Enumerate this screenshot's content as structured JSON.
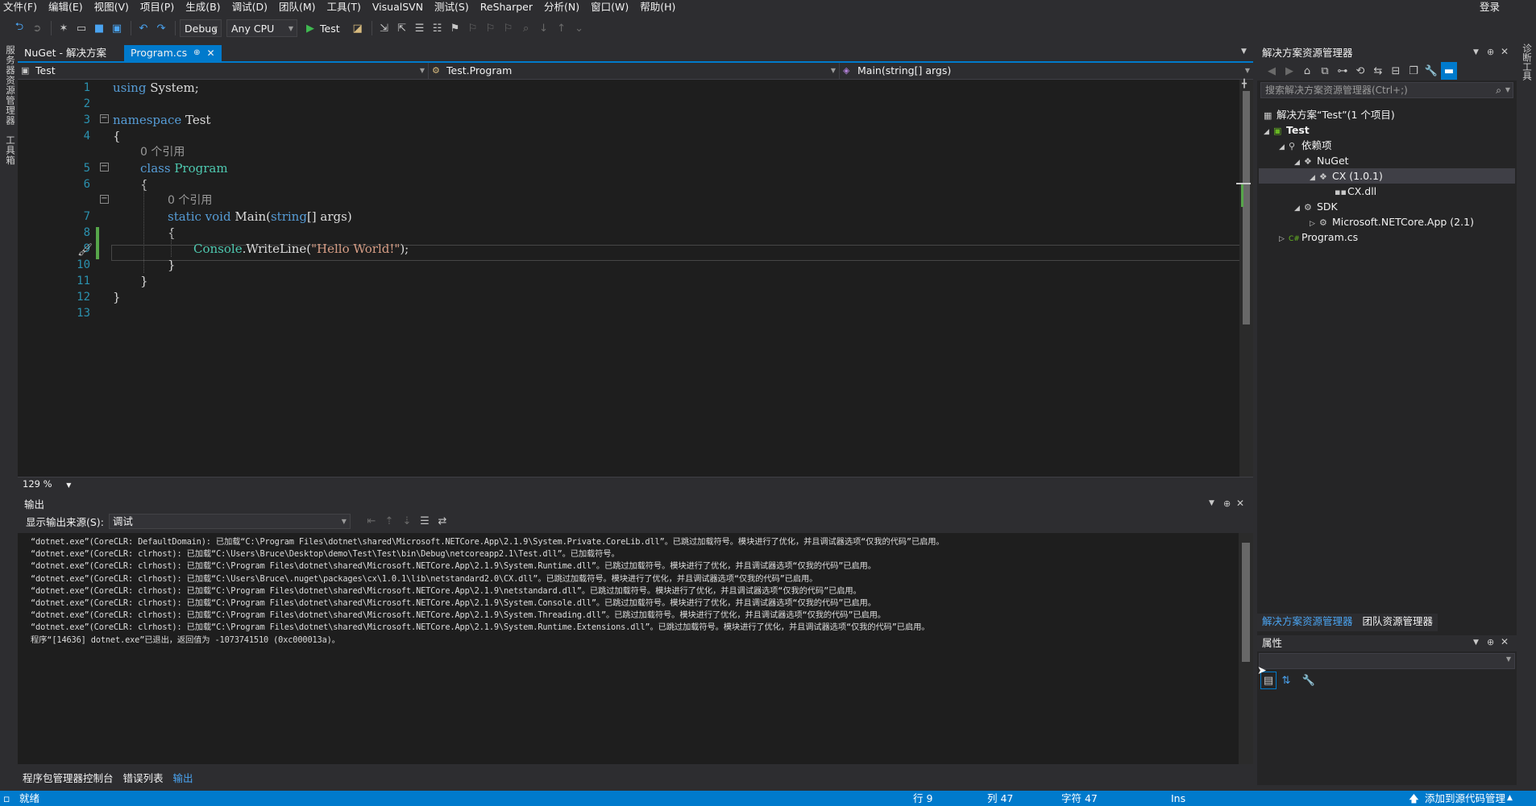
{
  "menu": {
    "items": [
      "文件(F)",
      "编辑(E)",
      "视图(V)",
      "项目(P)",
      "生成(B)",
      "调试(D)",
      "团队(M)",
      "工具(T)",
      "VisualSVN",
      "测试(S)",
      "ReSharper",
      "分析(N)",
      "窗口(W)",
      "帮助(H)"
    ],
    "login": "登录"
  },
  "toolbar": {
    "config": "Debug",
    "platform": "Any CPU",
    "run_label": "Test"
  },
  "left_strip": {
    "server_explorer": "服务器资源管理器",
    "toolbox": "工具箱"
  },
  "right_strip": {
    "diag": "诊断工具"
  },
  "editor_tabs": [
    {
      "label": "NuGet - 解决方案"
    },
    {
      "label": "Program.cs",
      "active": true
    }
  ],
  "nav": {
    "project": "Test",
    "type": "Test.Program",
    "member": "Main(string[] args)"
  },
  "editor": {
    "line_numbers": [
      "1",
      "2",
      "3",
      "4",
      "5",
      "6",
      "7",
      "8",
      "9",
      "10",
      "11",
      "12",
      "13"
    ],
    "code": {
      "using_kw": "using",
      "using_ns": " System;",
      "ns_kw": "namespace",
      "ns_name": " Test",
      "brace_open": "{",
      "brace_close": "}",
      "refs": "0 个引用",
      "class_kw": "class",
      "class_name": " Program",
      "static_kw": "static",
      "void_kw": " void",
      "main_name": " Main(",
      "string_kw": "string",
      "args": "[] args)",
      "console_type": "Console",
      "writeline": ".WriteLine(",
      "hello_str": "\"Hello World!\"",
      "end_stmt": ");"
    },
    "zoom": "129 %"
  },
  "output": {
    "title": "输出",
    "source_label": "显示输出来源(S):",
    "source_value": "调试",
    "lines": [
      "“dotnet.exe”(CoreCLR: DefaultDomain): 已加载“C:\\Program Files\\dotnet\\shared\\Microsoft.NETCore.App\\2.1.9\\System.Private.CoreLib.dll”。已跳过加载符号。模块进行了优化，并且调试器选项“仅我的代码”已启用。",
      "“dotnet.exe”(CoreCLR: clrhost): 已加载“C:\\Users\\Bruce\\Desktop\\demo\\Test\\Test\\bin\\Debug\\netcoreapp2.1\\Test.dll”。已加载符号。",
      "“dotnet.exe”(CoreCLR: clrhost): 已加载“C:\\Program Files\\dotnet\\shared\\Microsoft.NETCore.App\\2.1.9\\System.Runtime.dll”。已跳过加载符号。模块进行了优化，并且调试器选项“仅我的代码”已启用。",
      "“dotnet.exe”(CoreCLR: clrhost): 已加载“C:\\Users\\Bruce\\.nuget\\packages\\cx\\1.0.1\\lib\\netstandard2.0\\CX.dll”。已跳过加载符号。模块进行了优化，并且调试器选项“仅我的代码”已启用。",
      "“dotnet.exe”(CoreCLR: clrhost): 已加载“C:\\Program Files\\dotnet\\shared\\Microsoft.NETCore.App\\2.1.9\\netstandard.dll”。已跳过加载符号。模块进行了优化，并且调试器选项“仅我的代码”已启用。",
      "“dotnet.exe”(CoreCLR: clrhost): 已加载“C:\\Program Files\\dotnet\\shared\\Microsoft.NETCore.App\\2.1.9\\System.Console.dll”。已跳过加载符号。模块进行了优化，并且调试器选项“仅我的代码”已启用。",
      "“dotnet.exe”(CoreCLR: clrhost): 已加载“C:\\Program Files\\dotnet\\shared\\Microsoft.NETCore.App\\2.1.9\\System.Threading.dll”。已跳过加载符号。模块进行了优化，并且调试器选项“仅我的代码”已启用。",
      "“dotnet.exe”(CoreCLR: clrhost): 已加载“C:\\Program Files\\dotnet\\shared\\Microsoft.NETCore.App\\2.1.9\\System.Runtime.Extensions.dll”。已跳过加载符号。模块进行了优化，并且调试器选项“仅我的代码”已启用。",
      "程序“[14636] dotnet.exe”已退出，返回值为 -1073741510 (0xc000013a)。"
    ],
    "bottom_tabs": [
      "程序包管理器控制台",
      "错误列表",
      "输出"
    ]
  },
  "solution_explorer": {
    "title": "解决方案资源管理器",
    "search_placeholder": "搜索解决方案资源管理器(Ctrl+;)",
    "tree": [
      {
        "label": "解决方案“Test”(1 个项目)",
        "icon": "solution-icon"
      },
      {
        "label": "Test",
        "icon": "csharp-project-icon"
      },
      {
        "label": "依赖项",
        "icon": "dependencies-icon"
      },
      {
        "label": "NuGet",
        "icon": "nuget-icon"
      },
      {
        "label": "CX (1.0.1)",
        "icon": "package-icon"
      },
      {
        "label": "CX.dll",
        "icon": "assembly-icon"
      },
      {
        "label": "SDK",
        "icon": "sdk-icon"
      },
      {
        "label": "Microsoft.NETCore.App (2.1)",
        "icon": "package-icon"
      },
      {
        "label": "Program.cs",
        "icon": "csharp-file-icon"
      }
    ],
    "tabs": [
      "解决方案资源管理器",
      "团队资源管理器"
    ]
  },
  "properties": {
    "title": "属性"
  },
  "status": {
    "ready": "就绪",
    "line": "行 9",
    "col": "列 47",
    "char": "字符 47",
    "ins": "Ins",
    "source_control": "添加到源代码管理"
  },
  "colors": {
    "accent": "#007acc",
    "background": "#2d2d30",
    "editor_bg": "#1e1e1e",
    "keyword": "#569cd6",
    "type": "#4ec9b0",
    "string": "#d69d85",
    "line_number": "#2b91af"
  }
}
